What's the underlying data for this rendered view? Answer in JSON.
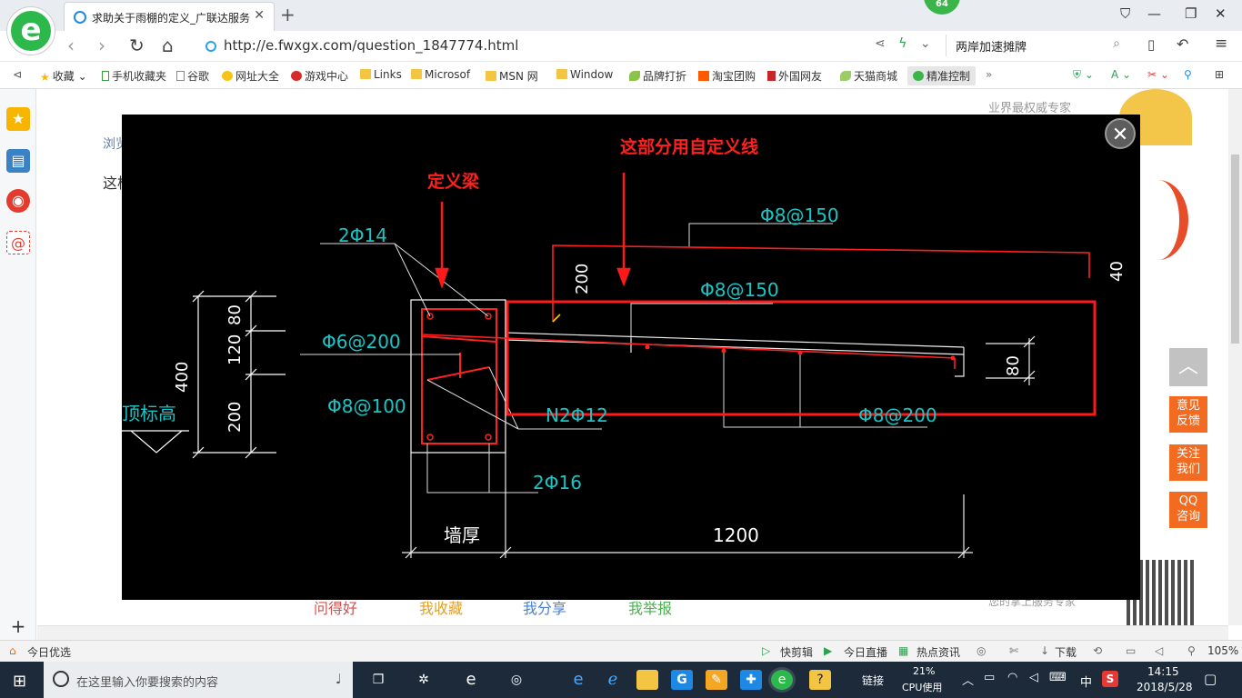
{
  "browser": {
    "logo_letter": "e",
    "tab_title": "求助关于雨棚的定义_广联达服务",
    "tab_close": "✕",
    "new_tab": "+",
    "badge_count": "64",
    "url": "http://e.fwxgx.com/question_1847774.html",
    "search_text": "两岸加速摊牌",
    "bookmarks": [
      "收藏",
      "手机收藏夹",
      "谷歌",
      "网址大全",
      "游戏中心",
      "Links",
      "Microsof",
      "MSN 网",
      "Window",
      "品牌打折",
      "淘宝团购",
      "外国网友",
      "天猫商城",
      "精准控制"
    ]
  },
  "page_behind": {
    "side_text": "业界最权威专家",
    "fragments": [
      "浏览",
      "这样"
    ],
    "actions": [
      "问得好",
      "我收藏",
      "我分享",
      "我举报"
    ],
    "right_bottom_text": "您的掌上服务专家"
  },
  "drawing": {
    "annot_custom_line": "这部分用自定义线",
    "annot_define_beam": "定义梁",
    "labels": {
      "top_bar": "2Φ14",
      "stirrup_beam": "Φ6@200",
      "side_bar": "Φ8@100",
      "bottom_bar": "2Φ16",
      "slab_top": "Φ8@150",
      "slab_mid": "Φ8@150",
      "slab_bottom": "Φ8@200",
      "n2": "N2Φ12",
      "dim_400": "400",
      "dim_80": "80",
      "dim_120": "120",
      "dim_200": "200",
      "dim_200_top": "200",
      "dim_40": "40",
      "dim_80_right": "80",
      "wall_thick": "墙厚",
      "span_1200": "1200",
      "elev_label": "顶标高",
      "small_side": "标高"
    }
  },
  "float_buttons": {
    "to_top": "︿",
    "feedback": [
      "意见",
      "反馈"
    ],
    "follow": [
      "关注",
      "我们"
    ],
    "qq": [
      "QQ",
      "咨询"
    ]
  },
  "statusbar": {
    "left": "今日优选",
    "items": [
      "快剪辑",
      "今日直播",
      "热点资讯",
      "下载"
    ],
    "zoom": "105%"
  },
  "taskbar": {
    "search_placeholder": "在这里输入你要搜索的内容",
    "cpu_percent": "21%",
    "cpu_label": "CPU使用",
    "link_label": "链接",
    "ime": "中",
    "time": "14:15",
    "date": "2018/5/28"
  }
}
